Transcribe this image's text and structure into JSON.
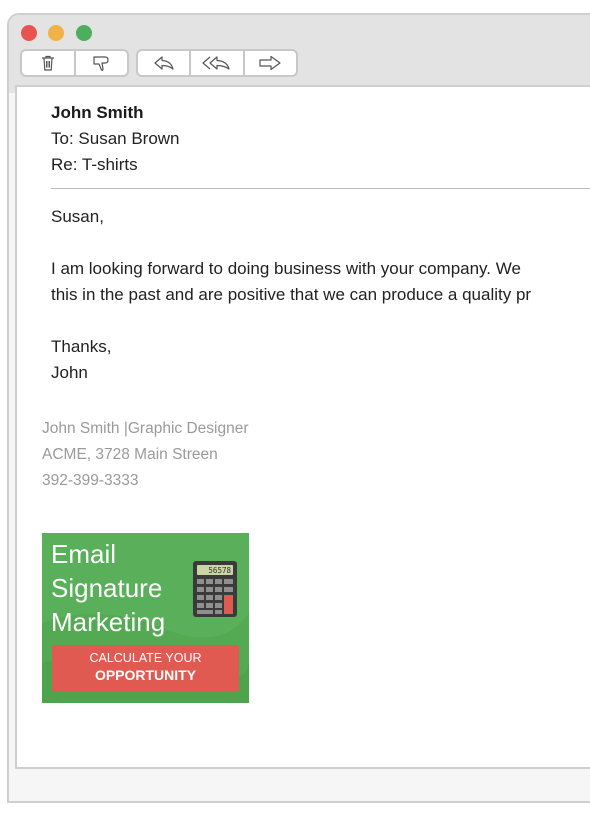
{
  "toolbar": {
    "buttons": [
      "trash-icon",
      "thumbs-down-icon",
      "reply-icon",
      "reply-all-icon",
      "forward-icon"
    ]
  },
  "email": {
    "from": "John Smith",
    "to": "To: Susan Brown",
    "subject": "Re: T-shirts",
    "greeting": "Susan,",
    "body_line1": "I am looking forward to doing business with your company.  We",
    "body_line2": "this in the past and are positive that we can produce a quality pr",
    "closing_line1": "Thanks,",
    "closing_line2": "John"
  },
  "signature": {
    "line1": "John Smith |Graphic Designer",
    "line2": "ACME, 3728 Main Streen",
    "line3": "392-399-3333"
  },
  "banner": {
    "title_line1": "Email",
    "title_line2": "Signature",
    "title_line3": "Marketing",
    "cta_line1": "CALCULATE YOUR",
    "cta_line2": "OPPORTUNITY",
    "calculator_display": "56578",
    "colors": {
      "background": "#5aaf5a",
      "cta": "#e05a52"
    }
  }
}
